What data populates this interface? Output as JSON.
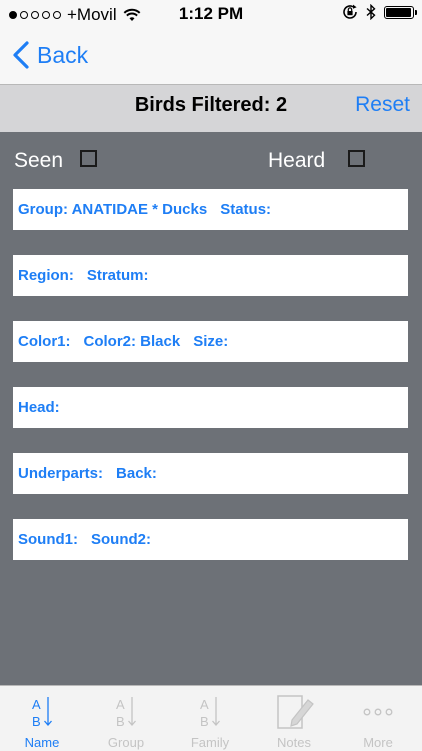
{
  "status_bar": {
    "carrier": "+Movil",
    "time": "1:12 PM"
  },
  "nav": {
    "back_label": "Back"
  },
  "filter": {
    "title": "Birds Filtered: 2",
    "reset_label": "Reset"
  },
  "checks": {
    "seen_label": "Seen",
    "heard_label": "Heard"
  },
  "rows": [
    [
      "Group: ANATIDAE * Ducks",
      "Status:"
    ],
    [
      "Region:",
      "Stratum:"
    ],
    [
      "Color1:",
      "Color2: Black",
      "Size:"
    ],
    [
      "Head:"
    ],
    [
      "Underparts:",
      "Back:"
    ],
    [
      "Sound1:",
      "Sound2:"
    ]
  ],
  "tabs": [
    {
      "label": "Name",
      "icon": "sort-ab-icon"
    },
    {
      "label": "Group",
      "icon": "sort-ab-icon"
    },
    {
      "label": "Family",
      "icon": "sort-ab-icon"
    },
    {
      "label": "Notes",
      "icon": "notes-pencil-icon"
    },
    {
      "label": "More",
      "icon": "more-dots-icon"
    }
  ],
  "colors": {
    "accent": "#1e7ef5",
    "background": "#6d7177",
    "tab_inactive": "#c4c4c4"
  }
}
